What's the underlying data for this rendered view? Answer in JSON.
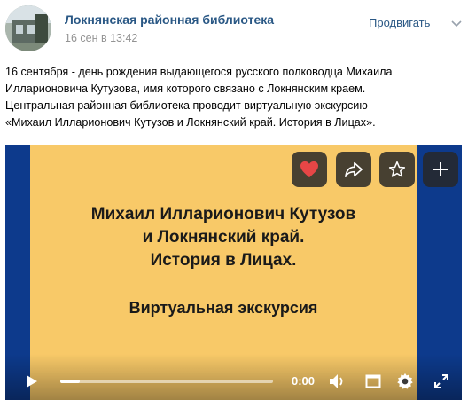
{
  "post": {
    "author": "Локнянская районная библиотека",
    "date": "16 сен в 13:42",
    "promote_label": "Продвигать",
    "text_lines": [
      "16 сентября - день рождения выдающегося русского полководца Михаила",
      "Илларионовича Кутузова, имя которого связано с Локнянским краем.",
      "Центральная районная библиотека проводит виртуальную экскурсию",
      "«Михаил Илларионович Кутузов и Локнянский край. История в Лицах»."
    ]
  },
  "video": {
    "slide_title_lines": [
      "Михаил Илларионович Кутузов",
      "и Локнянский край.",
      "История в Лицах."
    ],
    "slide_subtitle": "Виртуальная экскурсия",
    "time": "0:00",
    "progress": 0.09,
    "icons": {
      "like": "heart-icon",
      "share": "share-arrow-icon",
      "favorite": "star-icon",
      "add": "plus-icon",
      "play": "play-icon",
      "volume": "volume-icon",
      "miniplayer": "miniplayer-icon",
      "settings": "gear-icon",
      "fullscreen": "fullscreen-icon"
    },
    "colors": {
      "slide_background": "#f8c968",
      "frame_background": "#0d3a8c",
      "like_active": "#e64646"
    }
  }
}
